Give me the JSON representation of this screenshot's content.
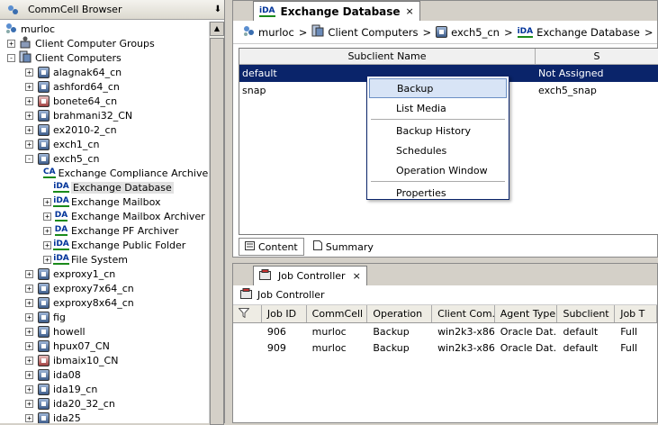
{
  "left_panel": {
    "title": "CommCell Browser",
    "pin": "⬇",
    "tree": [
      {
        "label": "murloc",
        "level": 0,
        "exp": "",
        "icon": "commcell"
      },
      {
        "label": "Client Computer Groups",
        "level": 1,
        "exp": "+",
        "icon": "group"
      },
      {
        "label": "Client Computers",
        "level": 1,
        "exp": "-",
        "icon": "clients"
      },
      {
        "label": "alagnak64_cn",
        "level": 2,
        "exp": "+",
        "icon": "pc"
      },
      {
        "label": "ashford64_cn",
        "level": 2,
        "exp": "+",
        "icon": "pc"
      },
      {
        "label": "bonete64_cn",
        "level": 2,
        "exp": "+",
        "icon": "pc-red"
      },
      {
        "label": "brahmani32_CN",
        "level": 2,
        "exp": "+",
        "icon": "pc"
      },
      {
        "label": "ex2010-2_cn",
        "level": 2,
        "exp": "+",
        "icon": "pc"
      },
      {
        "label": "exch1_cn",
        "level": 2,
        "exp": "+",
        "icon": "pc"
      },
      {
        "label": "exch5_cn",
        "level": 2,
        "exp": "-",
        "icon": "pc"
      },
      {
        "label": "Exchange Compliance Archiver",
        "level": 3,
        "exp": "",
        "icon": "CA"
      },
      {
        "label": "Exchange Database",
        "level": 3,
        "exp": "",
        "icon": "iDA",
        "selected": true
      },
      {
        "label": "Exchange Mailbox",
        "level": 3,
        "exp": "+",
        "icon": "iDA"
      },
      {
        "label": "Exchange Mailbox Archiver",
        "level": 3,
        "exp": "+",
        "icon": "DA"
      },
      {
        "label": "Exchange PF Archiver",
        "level": 3,
        "exp": "+",
        "icon": "DA"
      },
      {
        "label": "Exchange Public Folder",
        "level": 3,
        "exp": "+",
        "icon": "iDA"
      },
      {
        "label": "File System",
        "level": 3,
        "exp": "+",
        "icon": "iDA"
      },
      {
        "label": "exproxy1_cn",
        "level": 2,
        "exp": "+",
        "icon": "pc"
      },
      {
        "label": "exproxy7x64_cn",
        "level": 2,
        "exp": "+",
        "icon": "pc"
      },
      {
        "label": "exproxy8x64_cn",
        "level": 2,
        "exp": "+",
        "icon": "pc"
      },
      {
        "label": "fig",
        "level": 2,
        "exp": "+",
        "icon": "pc"
      },
      {
        "label": "howell",
        "level": 2,
        "exp": "+",
        "icon": "pc"
      },
      {
        "label": "hpux07_CN",
        "level": 2,
        "exp": "+",
        "icon": "pc"
      },
      {
        "label": "ibmaix10_CN",
        "level": 2,
        "exp": "+",
        "icon": "pc-red"
      },
      {
        "label": "ida08",
        "level": 2,
        "exp": "+",
        "icon": "pc"
      },
      {
        "label": "ida19_cn",
        "level": 2,
        "exp": "+",
        "icon": "pc"
      },
      {
        "label": "ida20_32_cn",
        "level": 2,
        "exp": "+",
        "icon": "pc"
      },
      {
        "label": "ida25",
        "level": 2,
        "exp": "+",
        "icon": "pc"
      }
    ]
  },
  "top_panel": {
    "tab_label": "Exchange Database",
    "tab_icon": "iDA",
    "tab_close": "×",
    "breadcrumb": [
      {
        "label": "murloc",
        "icon": "commcell"
      },
      {
        "label": "Client Computers",
        "icon": "clients"
      },
      {
        "label": "exch5_cn",
        "icon": "pc"
      },
      {
        "label": "Exchange Database",
        "icon": "iDA"
      }
    ],
    "crumb_sep": ">",
    "grid": {
      "headers": [
        "Subclient Name",
        "S"
      ],
      "rows": [
        {
          "name": "default",
          "storage": "Not Assigned",
          "selected": true
        },
        {
          "name": "snap",
          "storage": "exch5_snap",
          "selected": false
        }
      ]
    },
    "sub_tabs": [
      "Content",
      "Summary"
    ]
  },
  "context_menu": {
    "items": [
      {
        "label": "Backup",
        "hover": true,
        "sep_after": false
      },
      {
        "label": "List Media",
        "hover": false,
        "sep_after": true
      },
      {
        "label": "Backup History",
        "hover": false,
        "sep_after": false
      },
      {
        "label": "Schedules",
        "hover": false,
        "sep_after": false
      },
      {
        "label": "Operation Window",
        "hover": false,
        "sep_after": true
      },
      {
        "label": "Properties",
        "hover": false,
        "sep_after": false
      }
    ]
  },
  "job_panel": {
    "tab_label": "Job Controller",
    "tab_close": "×",
    "toolbar_label": "Job Controller",
    "headers": [
      "",
      "Job ID",
      "CommCell",
      "Operation",
      "Client Com...",
      "Agent Type",
      "Subclient",
      "Job T"
    ],
    "rows": [
      [
        "",
        "906",
        "murloc",
        "Backup",
        "win2k3-x86...",
        "Oracle Dat...",
        "default",
        "Full"
      ],
      [
        "",
        "909",
        "murloc",
        "Backup",
        "win2k3-x86...",
        "Oracle Dat...",
        "default",
        "Full"
      ]
    ]
  }
}
